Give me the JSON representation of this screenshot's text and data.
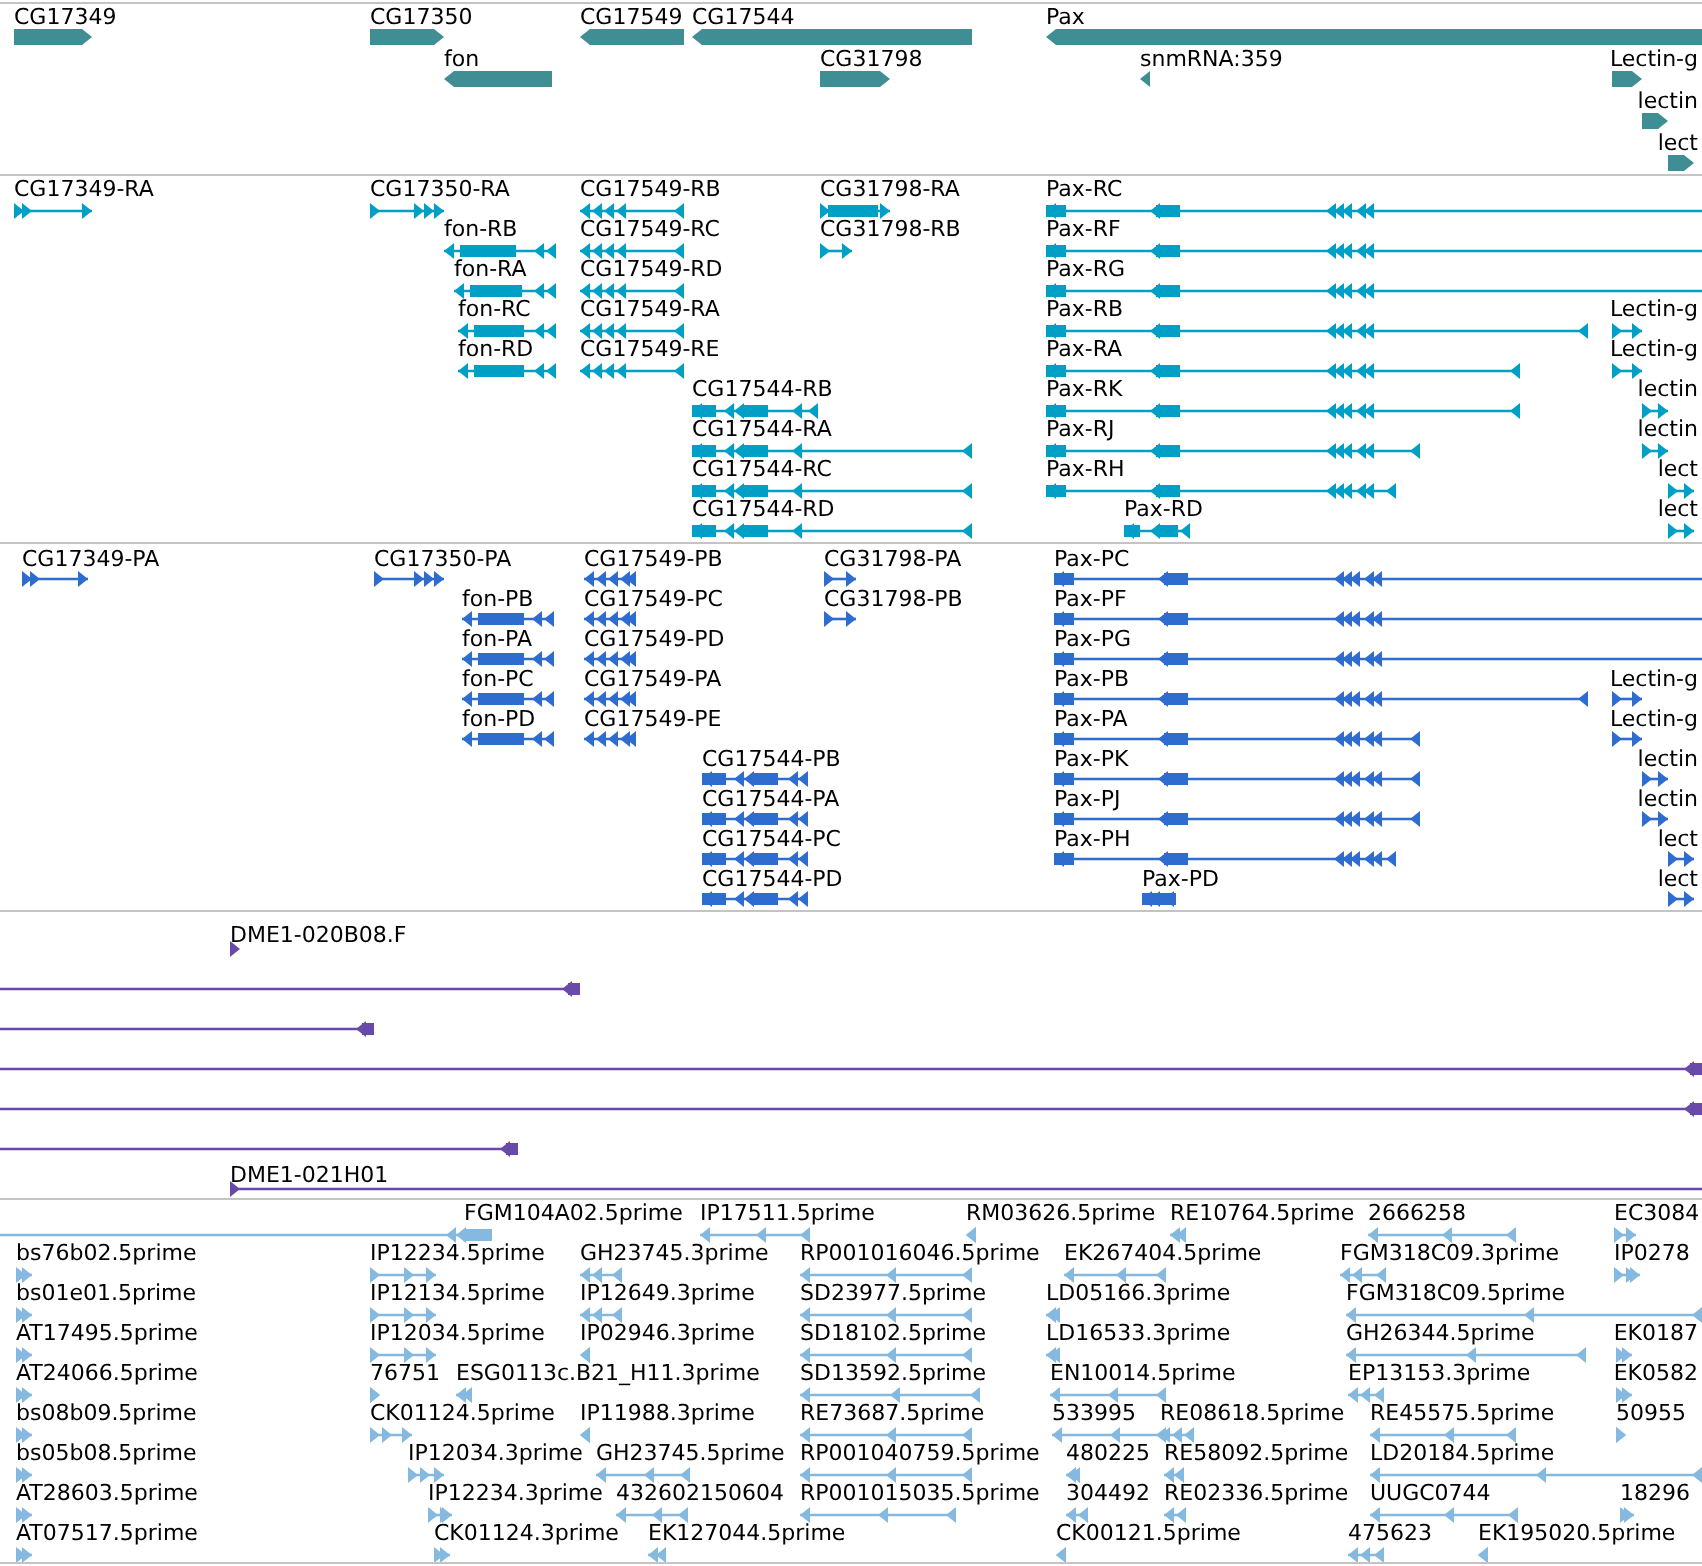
{
  "tracks": [
    {
      "kind": "gene",
      "rows": [
        {
          "features": [
            {
              "label": "CG17349",
              "reverse": false
            },
            {
              "label": "CG17350",
              "reverse": false
            },
            {
              "label": "CG17549",
              "reverse": true
            },
            {
              "label": "CG17544",
              "reverse": true
            },
            {
              "label": "Pax",
              "reverse": true
            }
          ]
        },
        {
          "features": [
            {
              "label": "fon",
              "reverse": true
            },
            {
              "label": "CG31798",
              "reverse": false
            },
            {
              "label": "snmRNA:359",
              "reverse": true
            },
            {
              "label": "Lectin-g",
              "reverse": false
            }
          ]
        },
        {
          "features": [
            {
              "label": "lectin",
              "reverse": false
            }
          ]
        },
        {
          "features": [
            {
              "label": "lect",
              "reverse": false
            }
          ]
        }
      ]
    },
    {
      "kind": "transcript",
      "rows": [
        {
          "features": [
            {
              "label": "CG17349-RA",
              "reverse": false
            },
            {
              "label": "CG17350-RA",
              "reverse": false
            },
            {
              "label": "CG17549-RB",
              "reverse": true
            },
            {
              "label": "CG31798-RA",
              "reverse": false
            },
            {
              "label": "Pax-RC",
              "reverse": true
            }
          ]
        },
        {
          "features": [
            {
              "label": "fon-RB",
              "reverse": true
            },
            {
              "label": "CG17549-RC",
              "reverse": true
            },
            {
              "label": "CG31798-RB",
              "reverse": false
            },
            {
              "label": "Pax-RF",
              "reverse": true
            }
          ]
        },
        {
          "features": [
            {
              "label": "fon-RA",
              "reverse": true
            },
            {
              "label": "CG17549-RD",
              "reverse": true
            },
            {
              "label": "Pax-RG",
              "reverse": true
            }
          ]
        },
        {
          "features": [
            {
              "label": "fon-RC",
              "reverse": true
            },
            {
              "label": "CG17549-RA",
              "reverse": true
            },
            {
              "label": "Pax-RB",
              "reverse": true
            },
            {
              "label": "Lectin-g",
              "reverse": false
            }
          ]
        },
        {
          "features": [
            {
              "label": "fon-RD",
              "reverse": true
            },
            {
              "label": "CG17549-RE",
              "reverse": true
            },
            {
              "label": "Pax-RA",
              "reverse": true
            },
            {
              "label": "Lectin-g",
              "reverse": false
            }
          ]
        },
        {
          "features": [
            {
              "label": "CG17544-RB",
              "reverse": true
            },
            {
              "label": "Pax-RK",
              "reverse": true
            },
            {
              "label": "lectin",
              "reverse": false
            }
          ]
        },
        {
          "features": [
            {
              "label": "CG17544-RA",
              "reverse": true
            },
            {
              "label": "Pax-RJ",
              "reverse": true
            },
            {
              "label": "lectin",
              "reverse": false
            }
          ]
        },
        {
          "features": [
            {
              "label": "CG17544-RC",
              "reverse": true
            },
            {
              "label": "Pax-RH",
              "reverse": true
            },
            {
              "label": "lect",
              "reverse": false
            }
          ]
        },
        {
          "features": [
            {
              "label": "CG17544-RD",
              "reverse": true
            },
            {
              "label": "Pax-RD",
              "reverse": true
            },
            {
              "label": "lect",
              "reverse": false
            }
          ]
        }
      ]
    },
    {
      "kind": "protein",
      "rows": [
        {
          "features": [
            {
              "label": "CG17349-PA",
              "reverse": false
            },
            {
              "label": "CG17350-PA",
              "reverse": false
            },
            {
              "label": "CG17549-PB",
              "reverse": true
            },
            {
              "label": "CG31798-PA",
              "reverse": false
            },
            {
              "label": "Pax-PC",
              "reverse": true
            }
          ]
        },
        {
          "features": [
            {
              "label": "fon-PB",
              "reverse": true
            },
            {
              "label": "CG17549-PC",
              "reverse": true
            },
            {
              "label": "CG31798-PB",
              "reverse": false
            },
            {
              "label": "Pax-PF",
              "reverse": true
            }
          ]
        },
        {
          "features": [
            {
              "label": "fon-PA",
              "reverse": true
            },
            {
              "label": "CG17549-PD",
              "reverse": true
            },
            {
              "label": "Pax-PG",
              "reverse": true
            }
          ]
        },
        {
          "features": [
            {
              "label": "fon-PC",
              "reverse": true
            },
            {
              "label": "CG17549-PA",
              "reverse": true
            },
            {
              "label": "Pax-PB",
              "reverse": true
            },
            {
              "label": "Lectin-g",
              "reverse": false
            }
          ]
        },
        {
          "features": [
            {
              "label": "fon-PD",
              "reverse": true
            },
            {
              "label": "CG17549-PE",
              "reverse": true
            },
            {
              "label": "Pax-PA",
              "reverse": true
            },
            {
              "label": "Lectin-g",
              "reverse": false
            }
          ]
        },
        {
          "features": [
            {
              "label": "CG17544-PB",
              "reverse": true
            },
            {
              "label": "Pax-PK",
              "reverse": true
            },
            {
              "label": "lectin",
              "reverse": false
            }
          ]
        },
        {
          "features": [
            {
              "label": "CG17544-PA",
              "reverse": true
            },
            {
              "label": "Pax-PJ",
              "reverse": true
            },
            {
              "label": "lectin",
              "reverse": false
            }
          ]
        },
        {
          "features": [
            {
              "label": "CG17544-PC",
              "reverse": true
            },
            {
              "label": "Pax-PH",
              "reverse": true
            },
            {
              "label": "lect",
              "reverse": false
            }
          ]
        },
        {
          "features": [
            {
              "label": "CG17544-PD",
              "reverse": true
            },
            {
              "label": "Pax-PD",
              "reverse": true
            },
            {
              "label": "lect",
              "reverse": false
            }
          ]
        }
      ]
    },
    {
      "kind": "alignment",
      "rows": [
        {
          "features": [
            {
              "label": "DME1-020B08.F",
              "reverse": false
            }
          ]
        },
        {
          "features": [
            {
              "reverse": true
            }
          ]
        },
        {
          "features": [
            {
              "reverse": true
            }
          ]
        },
        {
          "features": [
            {
              "reverse": true
            }
          ]
        },
        {
          "features": [
            {
              "reverse": true
            }
          ]
        },
        {
          "features": [
            {
              "reverse": true
            }
          ]
        },
        {
          "features": [
            {
              "label": "DME1-021H01",
              "reverse": false
            }
          ]
        }
      ]
    },
    {
      "kind": "est",
      "rows": [
        {
          "features": [
            {
              "label": "FGM104A02.5prime",
              "reverse": true
            },
            {
              "label": "IP17511.5prime",
              "reverse": true
            },
            {
              "label": "RM03626.5prime",
              "reverse": true
            },
            {
              "label": "RE10764.5prime",
              "reverse": true
            },
            {
              "label": "2666258",
              "reverse": true
            },
            {
              "label": "EC3084",
              "reverse": false
            }
          ]
        },
        {
          "features": [
            {
              "label": "bs76b02.5prime",
              "reverse": false
            },
            {
              "label": "IP12234.5prime",
              "reverse": false
            },
            {
              "label": "GH23745.3prime",
              "reverse": true
            },
            {
              "label": "RP001016046.5prime",
              "reverse": true
            },
            {
              "label": "EK267404.5prime",
              "reverse": true
            },
            {
              "label": "FGM318C09.3prime",
              "reverse": true
            },
            {
              "label": "IP0278",
              "reverse": false
            }
          ]
        },
        {
          "features": [
            {
              "label": "bs01e01.5prime",
              "reverse": false
            },
            {
              "label": "IP12134.5prime",
              "reverse": false
            },
            {
              "label": "IP12649.3prime",
              "reverse": true
            },
            {
              "label": "SD23977.5prime",
              "reverse": true
            },
            {
              "label": "LD05166.3prime",
              "reverse": true
            },
            {
              "label": "FGM318C09.5prime",
              "reverse": true
            }
          ]
        },
        {
          "features": [
            {
              "label": "AT17495.5prime",
              "reverse": false
            },
            {
              "label": "IP12034.5prime",
              "reverse": false
            },
            {
              "label": "IP02946.3prime",
              "reverse": true
            },
            {
              "label": "SD18102.5prime",
              "reverse": true
            },
            {
              "label": "LD16533.3prime",
              "reverse": true
            },
            {
              "label": "GH26344.5prime",
              "reverse": true
            },
            {
              "label": "EK0187",
              "reverse": false
            }
          ]
        },
        {
          "features": [
            {
              "label": "AT24066.5prime",
              "reverse": false
            },
            {
              "label": "76751",
              "reverse": false
            },
            {
              "label": "ESG0113c.B21_H11.3prime",
              "reverse": true
            },
            {
              "label": "SD13592.5prime",
              "reverse": true
            },
            {
              "label": "EN10014.5prime",
              "reverse": true
            },
            {
              "label": "EP13153.3prime",
              "reverse": true
            },
            {
              "label": "EK0582",
              "reverse": false
            }
          ]
        },
        {
          "features": [
            {
              "label": "bs08b09.5prime",
              "reverse": false
            },
            {
              "label": "CK01124.5prime",
              "reverse": false
            },
            {
              "label": "IP11988.3prime",
              "reverse": true
            },
            {
              "label": "RE73687.5prime",
              "reverse": true
            },
            {
              "label": "533995",
              "reverse": true
            },
            {
              "label": "RE08618.5prime",
              "reverse": true
            },
            {
              "label": "RE45575.5prime",
              "reverse": true
            },
            {
              "label": "50955",
              "reverse": false
            }
          ]
        },
        {
          "features": [
            {
              "label": "bs05b08.5prime",
              "reverse": false
            },
            {
              "label": "IP12034.3prime",
              "reverse": false
            },
            {
              "label": "GH23745.5prime",
              "reverse": true
            },
            {
              "label": "RP001040759.5prime",
              "reverse": true
            },
            {
              "label": "480225",
              "reverse": true
            },
            {
              "label": "RE58092.5prime",
              "reverse": true
            },
            {
              "label": "LD20184.5prime",
              "reverse": true
            }
          ]
        },
        {
          "features": [
            {
              "label": "AT28603.5prime",
              "reverse": false
            },
            {
              "label": "IP12234.3prime",
              "reverse": false
            },
            {
              "label": "432602150604",
              "reverse": true
            },
            {
              "label": "RP001015035.5prime",
              "reverse": true
            },
            {
              "label": "304492",
              "reverse": true
            },
            {
              "label": "RE02336.5prime",
              "reverse": true
            },
            {
              "label": "UUGC0744",
              "reverse": true
            },
            {
              "label": "18296",
              "reverse": false
            }
          ]
        },
        {
          "features": [
            {
              "label": "AT07517.5prime",
              "reverse": false
            },
            {
              "label": "CK01124.3prime",
              "reverse": false
            },
            {
              "label": "EK127044.5prime",
              "reverse": true
            },
            {
              "label": "CK00121.5prime",
              "reverse": true
            },
            {
              "label": "475623",
              "reverse": true
            },
            {
              "label": "EK195020.5prime",
              "reverse": true
            }
          ]
        }
      ]
    }
  ]
}
